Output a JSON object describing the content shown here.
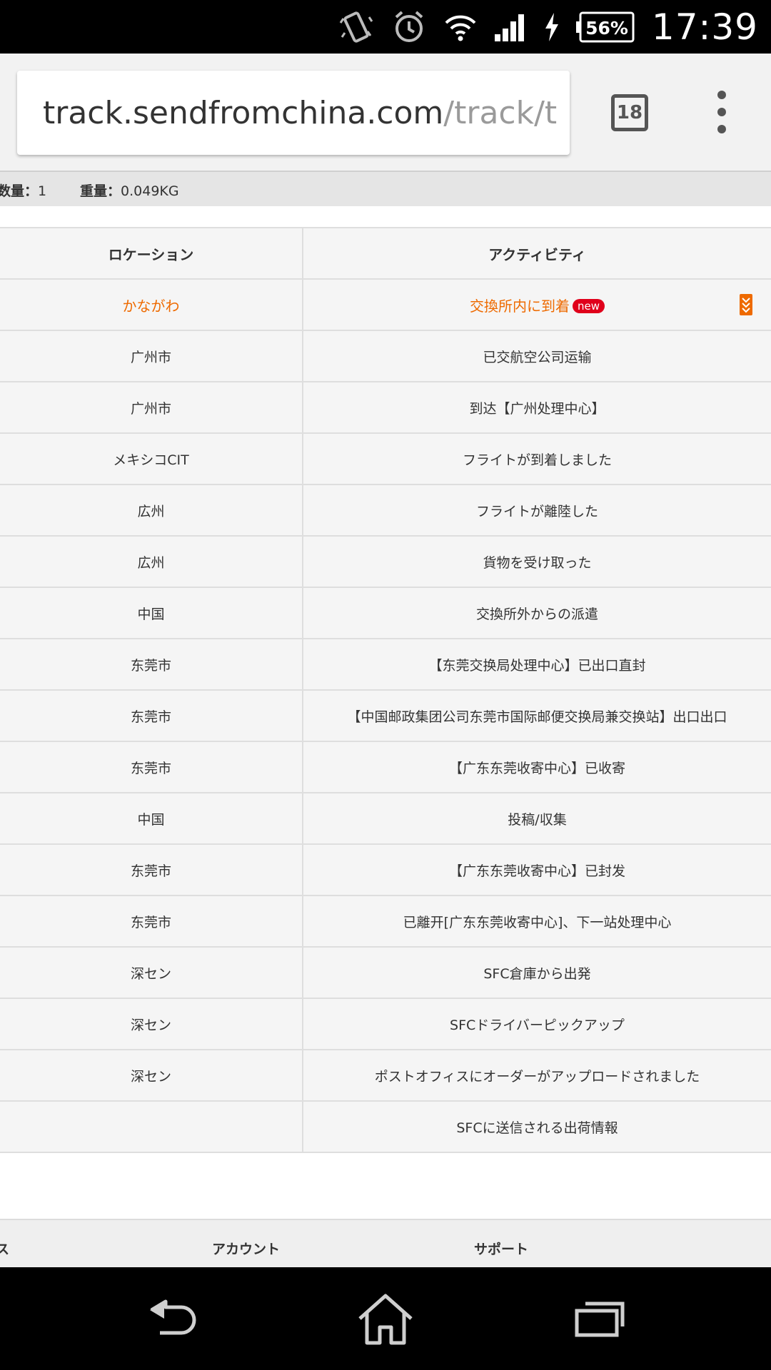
{
  "status_bar": {
    "battery": "56%",
    "time": "17:39",
    "icons": [
      "vibrate-icon",
      "alarm-icon",
      "wifi-icon",
      "signal-icon",
      "charging-icon",
      "battery-icon"
    ]
  },
  "browser": {
    "url_host": "track.sendfromchina.com",
    "url_path": "/track/t",
    "tab_count": "18"
  },
  "summary": {
    "qty_label": "数量：",
    "qty_value": "1",
    "weight_label": "重量：",
    "weight_value": "0.049KG"
  },
  "table": {
    "headers": {
      "location": "ロケーション",
      "activity": "アクティビティ"
    },
    "rows": [
      {
        "location": "かながわ",
        "activity": "交換所内に到着",
        "badge": "new"
      },
      {
        "location": "广州市",
        "activity": "已交航空公司运输"
      },
      {
        "location": "广州市",
        "activity": "到达【广州处理中心】"
      },
      {
        "location": "メキシコCIT",
        "activity": "フライトが到着しました"
      },
      {
        "location": "広州",
        "activity": "フライトが離陸した"
      },
      {
        "location": "広州",
        "activity": "貨物を受け取った"
      },
      {
        "location": "中国",
        "activity": "交換所外からの派遣"
      },
      {
        "location": "东莞市",
        "activity": "【东莞交换局处理中心】已出口直封"
      },
      {
        "location": "东莞市",
        "activity": "【中国邮政集团公司东莞市国际邮便交换局兼交换站】出口出口"
      },
      {
        "location": "东莞市",
        "activity": "【广东东莞收寄中心】已收寄"
      },
      {
        "location": "中国",
        "activity": "投稿/収集"
      },
      {
        "location": "东莞市",
        "activity": "【广东东莞收寄中心】已封发"
      },
      {
        "location": "东莞市",
        "activity": "已離开[广东东莞收寄中心]、下一站处理中心"
      },
      {
        "location": "深セン",
        "activity": "SFC倉庫から出発"
      },
      {
        "location": "深セン",
        "activity": "SFCドライバーピックアップ"
      },
      {
        "location": "深セン",
        "activity": "ポストオフィスにオーダーがアップロードされました"
      },
      {
        "location": "",
        "activity": "SFCに送信される出荷情報"
      }
    ]
  },
  "footer": {
    "col1": "ス",
    "col2": "アカウント",
    "col3": "サポート"
  },
  "colors": {
    "accent": "#ee6a00",
    "badge": "#e0001b"
  }
}
